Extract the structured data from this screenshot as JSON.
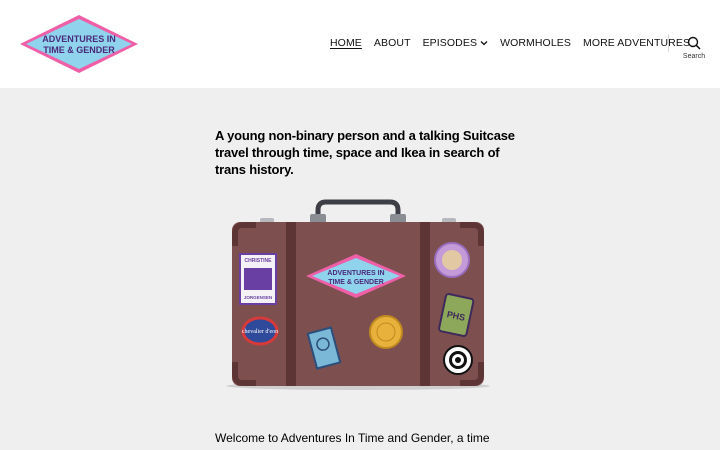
{
  "logo": {
    "line1": "ADVENTURES IN",
    "line2": "TIME & GENDER"
  },
  "nav": {
    "items": [
      {
        "label": "HOME",
        "active": true
      },
      {
        "label": "ABOUT"
      },
      {
        "label": "EPISODES",
        "has_dropdown": true
      },
      {
        "label": "WORMHOLES"
      },
      {
        "label": "MORE ADVENTURES"
      }
    ]
  },
  "search": {
    "label": "Search"
  },
  "main": {
    "tagline": "A young non-binary person and a talking Suitcase travel through time, space and Ikea in search of trans history.",
    "suitcase": {
      "sticker_christine_top": "CHRISTINE",
      "sticker_christine_bottom": "JORGENSEN",
      "sticker_chevalier": "chevalier d'eon",
      "sticker_phs": "PHS",
      "sticker_logo_line1": "ADVENTURES IN",
      "sticker_logo_line2": "TIME & GENDER"
    },
    "intro": "Welcome to Adventures In Time and Gender, a time"
  },
  "colors": {
    "logo_pink": "#ef5fa7",
    "logo_blue": "#8fd3ec",
    "logo_purple": "#4a2a7a",
    "suitcase_body": "#7e4f4f",
    "suitcase_dark": "#5e3535",
    "background": "#efefef"
  }
}
